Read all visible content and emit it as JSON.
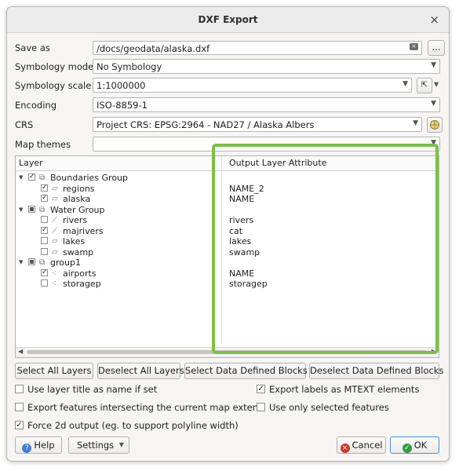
{
  "window": {
    "title": "DXF Export",
    "close_glyph": "×"
  },
  "form": {
    "save_as": {
      "label": "Save as",
      "value": "/docs/geodata/alaska.dxf",
      "browse_label": "..."
    },
    "symbology_mode": {
      "label": "Symbology mode",
      "value": "No Symbology"
    },
    "symbology_scale": {
      "label": "Symbology scale",
      "value": "1:1000000"
    },
    "encoding": {
      "label": "Encoding",
      "value": "ISO-8859-1"
    },
    "crs": {
      "label": "CRS",
      "value": "Project CRS: EPSG:2964 - NAD27 / Alaska Albers"
    },
    "map_themes": {
      "label": "Map themes",
      "value": ""
    }
  },
  "tree": {
    "header_layer": "Layer",
    "header_attribute": "Output Layer Attribute",
    "rows": [
      {
        "name": "Boundaries Group",
        "level": 0,
        "group": true,
        "state": "checked",
        "attr": ""
      },
      {
        "name": "regions",
        "level": 1,
        "group": false,
        "state": "checked",
        "geom": "polygon",
        "attr": "NAME_2"
      },
      {
        "name": "alaska",
        "level": 1,
        "group": false,
        "state": "checked",
        "geom": "polygon",
        "attr": "NAME"
      },
      {
        "name": "Water Group",
        "level": 0,
        "group": true,
        "state": "partial",
        "attr": ""
      },
      {
        "name": "rivers",
        "level": 1,
        "group": false,
        "state": "unchecked",
        "geom": "line",
        "attr": "rivers"
      },
      {
        "name": "majrivers",
        "level": 1,
        "group": false,
        "state": "checked",
        "geom": "line",
        "attr": "cat"
      },
      {
        "name": "lakes",
        "level": 1,
        "group": false,
        "state": "unchecked",
        "geom": "polygon",
        "attr": "lakes"
      },
      {
        "name": "swamp",
        "level": 1,
        "group": false,
        "state": "unchecked",
        "geom": "polygon",
        "attr": "swamp"
      },
      {
        "name": "group1",
        "level": 0,
        "group": true,
        "state": "partial",
        "attr": ""
      },
      {
        "name": "airports",
        "level": 1,
        "group": false,
        "state": "checked",
        "geom": "point",
        "attr": "NAME"
      },
      {
        "name": "storagep",
        "level": 1,
        "group": false,
        "state": "unchecked",
        "geom": "point",
        "attr": "storagep"
      }
    ]
  },
  "layer_buttons": {
    "select_all": "Select All Layers",
    "deselect_all": "Deselect All Layers",
    "select_dd": "Select Data Defined Blocks",
    "deselect_dd": "Deselect Data Defined Blocks"
  },
  "options": {
    "layer_title": {
      "label": "Use layer title as name if set",
      "checked": false
    },
    "mtext": {
      "label": "Export labels as MTEXT elements",
      "checked": true
    },
    "intersect": {
      "label": "Export features intersecting the current map extent",
      "checked": false
    },
    "selected_only": {
      "label": "Use only selected features",
      "checked": false
    },
    "force2d": {
      "label": "Force 2d output (eg. to support polyline width)",
      "checked": true
    }
  },
  "footer": {
    "help": "Help",
    "settings": "Settings",
    "cancel": "Cancel",
    "ok": "OK"
  },
  "colors": {
    "highlight": "#7ac143",
    "ok_icon": "#2e9e3e",
    "cancel_icon": "#d0352b",
    "help_icon": "#3d7fd1"
  }
}
